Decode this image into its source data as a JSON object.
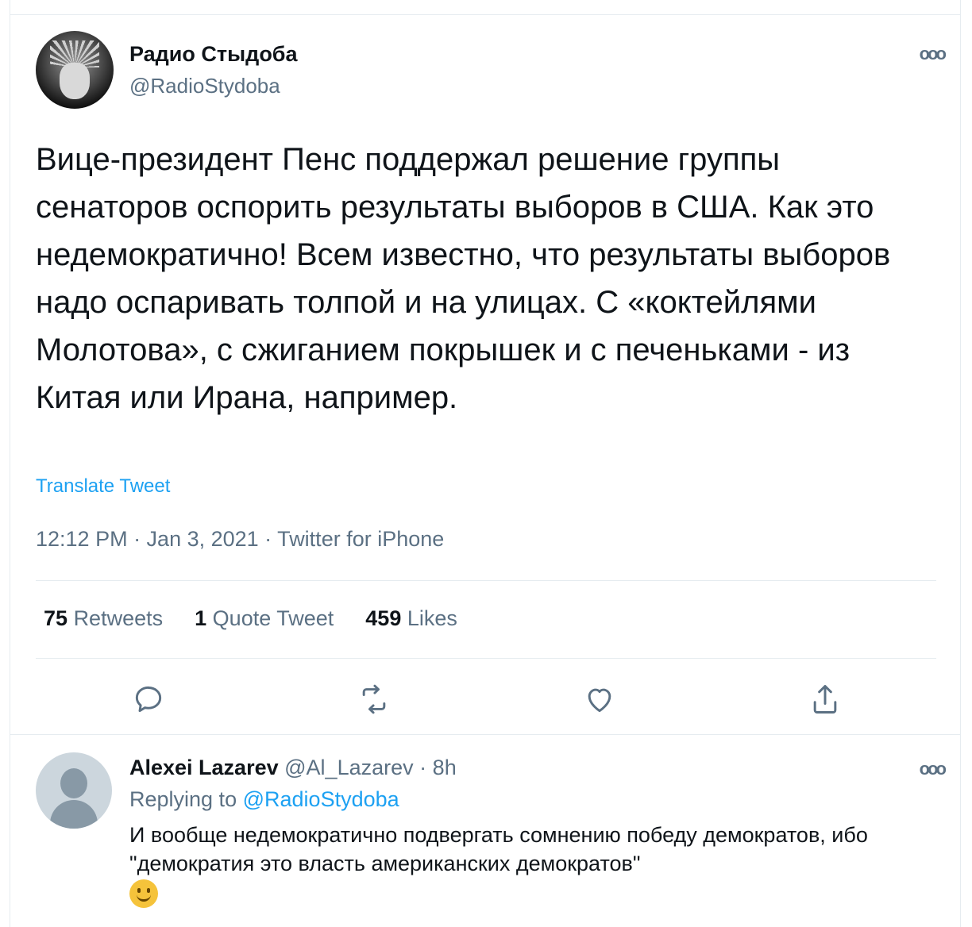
{
  "tweet": {
    "author_name": "Радио Стыдоба",
    "author_handle": "@RadioStydoba",
    "text": "Вице-президент Пенс поддержал решение группы сенаторов оспорить результаты выборов в США. Как это недемократично! Всем известно, что результаты выборов надо оспаривать толпой и на улицах. С «коктейлями Молотова», с сжиганием покрышек и с печеньками - из Китая или Ирана, например.",
    "translate_label": "Translate Tweet",
    "meta": "12:12 PM · Jan 3, 2021 · Twitter for iPhone",
    "stats": {
      "retweets_count": "75",
      "retweets_label": "Retweets",
      "quotes_count": "1",
      "quotes_label": "Quote Tweet",
      "likes_count": "459",
      "likes_label": "Likes"
    },
    "more_icon": "more-icon"
  },
  "reply": {
    "author_name": "Alexei Lazarev",
    "author_handle": "@Al_Lazarev",
    "separator": "·",
    "time": "8h",
    "replying_prefix": "Replying to",
    "replying_to": "@RadioStydoba",
    "text": "И вообще недемократично подвергать сомнению победу демократов, ибо \"демократия это власть американских демократов\"",
    "emoji": "slightly-smiling-face"
  },
  "colors": {
    "accent": "#1da1f2",
    "secondary_text": "#5b7083",
    "border": "#e6ecf0"
  }
}
